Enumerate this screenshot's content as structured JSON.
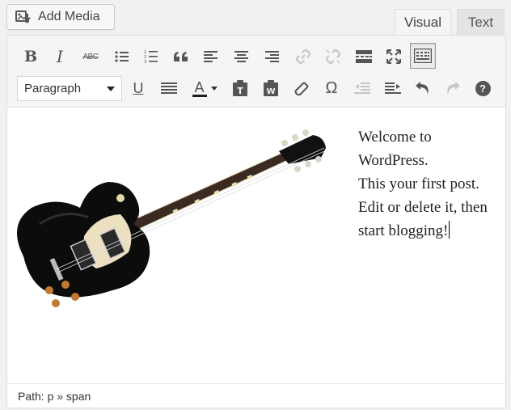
{
  "media_button": {
    "label": "Add Media",
    "icon": "add-media-icon"
  },
  "tabs": [
    {
      "label": "Visual",
      "active": true
    },
    {
      "label": "Text",
      "active": false
    }
  ],
  "toolbar": {
    "row1": [
      {
        "name": "bold",
        "glyph": "B"
      },
      {
        "name": "italic",
        "glyph": "I"
      },
      {
        "name": "strikethrough",
        "glyph": "ABC"
      },
      {
        "name": "bulleted-list"
      },
      {
        "name": "numbered-list"
      },
      {
        "name": "blockquote"
      },
      {
        "name": "align-left"
      },
      {
        "name": "align-center"
      },
      {
        "name": "align-right"
      },
      {
        "name": "insert-link",
        "disabled": true
      },
      {
        "name": "remove-link",
        "disabled": true
      },
      {
        "name": "read-more"
      },
      {
        "name": "fullscreen"
      },
      {
        "name": "toolbar-toggle",
        "active": true
      }
    ],
    "format_select": {
      "value": "Paragraph"
    },
    "row2": [
      {
        "name": "underline",
        "glyph": "U"
      },
      {
        "name": "justify"
      },
      {
        "name": "text-color",
        "glyph": "A"
      },
      {
        "name": "paste-as-text"
      },
      {
        "name": "paste-from-word"
      },
      {
        "name": "clear-formatting"
      },
      {
        "name": "special-character",
        "glyph": "Ω"
      },
      {
        "name": "outdent",
        "disabled": true
      },
      {
        "name": "indent"
      },
      {
        "name": "undo"
      },
      {
        "name": "redo",
        "disabled": true
      },
      {
        "name": "help",
        "glyph": "?"
      }
    ]
  },
  "content": {
    "image": "electric-guitar-image",
    "paragraph_lines": [
      "Welcome to",
      "WordPress.",
      "This your first post.",
      "Edit or delete it, then",
      "start blogging!"
    ]
  },
  "statusbar": {
    "path": "Path: p » span"
  },
  "colors": {
    "text_color_underline": "#1e1e1e",
    "toolbar_bg": "#f5f5f5"
  }
}
